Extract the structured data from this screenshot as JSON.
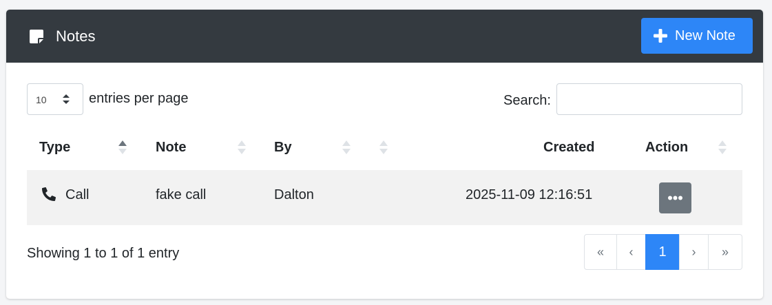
{
  "card": {
    "title": "Notes",
    "new_button_label": "New Note",
    "header_color": "#343a40",
    "accent_color": "#2d86f7",
    "title_icon": "sticky-note-icon",
    "new_button_icon": "plus-icon"
  },
  "controls": {
    "page_length_value": "10",
    "page_length_label": "entries per page",
    "search_label": "Search:",
    "search_value": ""
  },
  "table": {
    "columns": [
      {
        "label": "Type",
        "sort": "ascending"
      },
      {
        "label": "Note",
        "sort": "none"
      },
      {
        "label": "By",
        "sort": "none"
      },
      {
        "label": "",
        "sort": "none"
      },
      {
        "label": "Created",
        "sort": "none"
      },
      {
        "label": "Action",
        "sort": "none"
      }
    ],
    "rows": [
      {
        "type_icon": "phone-icon",
        "type": "Call",
        "note": "fake call",
        "by": "Dalton",
        "created": "2025-11-09 12:16:51",
        "action_icon": "ellipsis-icon"
      }
    ]
  },
  "footer": {
    "info": "Showing 1 to 1 of 1 entry",
    "pagination": [
      {
        "label": "«"
      },
      {
        "label": "‹"
      },
      {
        "label": "1",
        "active": true
      },
      {
        "label": "›"
      },
      {
        "label": "»"
      }
    ]
  }
}
